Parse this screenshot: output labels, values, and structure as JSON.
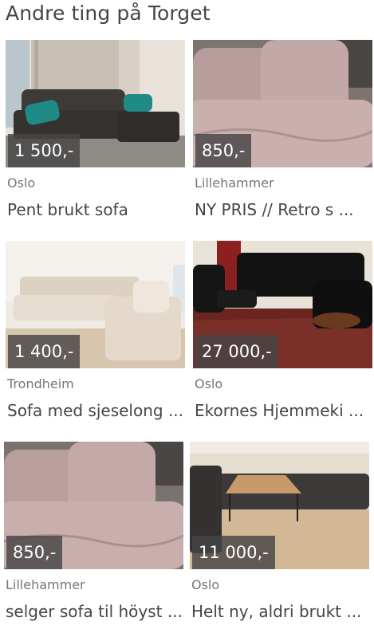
{
  "section": {
    "heading": "Andre ting på Torget"
  },
  "listings": [
    {
      "price": "1 500,-",
      "location": "Oslo",
      "title": "Pent brukt sofa"
    },
    {
      "price": "850,-",
      "location": "Lillehammer",
      "title": "NY PRIS // Retro s ..."
    },
    {
      "price": "1 400,-",
      "location": "Trondheim",
      "title": "Sofa med sjeselong ..."
    },
    {
      "price": "27 000,-",
      "location": "Oslo",
      "title": "Ekornes Hjemmeki ..."
    },
    {
      "price": "850,-",
      "location": "Lillehammer",
      "title": "selger sofa til höyst ..."
    },
    {
      "price": "11 000,-",
      "location": "Oslo",
      "title": "Helt ny, aldri brukt ..."
    }
  ]
}
